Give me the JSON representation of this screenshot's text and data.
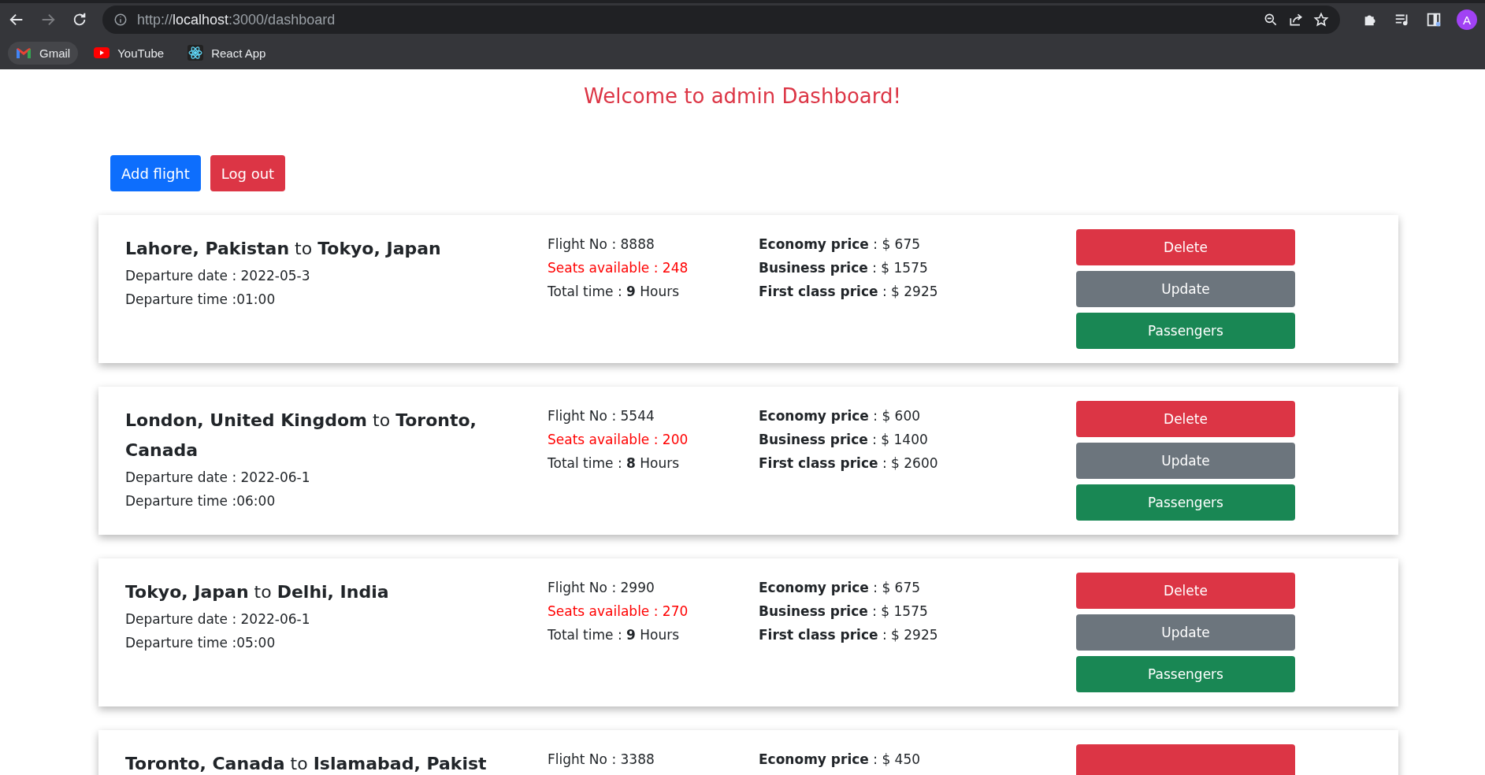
{
  "browser": {
    "url_scheme": "http://",
    "url_host": "localhost",
    "url_rest": ":3000/dashboard",
    "avatar": "A",
    "bookmarks": [
      {
        "label": "Gmail",
        "kind": "gmail",
        "highlighted": true
      },
      {
        "label": "YouTube",
        "kind": "youtube",
        "highlighted": false
      },
      {
        "label": "React App",
        "kind": "react",
        "highlighted": false
      }
    ]
  },
  "heading": "Welcome to admin Dashboard!",
  "actions": [
    {
      "label": "Add flight",
      "kind": "primary"
    },
    {
      "label": "Log out",
      "kind": "danger"
    }
  ],
  "flights": [
    {
      "route": "**Lahore, Pakistan** to **Tokyo, Japan**",
      "details": [
        "Departure date : 2022-05-3",
        "Departure time :01:00"
      ],
      "info": [
        {
          "text": "Flight No : 8888",
          "kind": "plain"
        },
        {
          "text": "Seats available : 248",
          "kind": "alert"
        },
        {
          "text": "Total time : **9** Hours",
          "kind": "plain"
        }
      ],
      "prices": [
        "**Economy price** : $ 675",
        "**Business price** : $ 1575",
        "**First class price** : $ 2925"
      ],
      "buttons": [
        {
          "label": "Delete",
          "kind": "danger"
        },
        {
          "label": "Update",
          "kind": "secondary"
        },
        {
          "label": "Passengers",
          "kind": "success"
        }
      ]
    },
    {
      "route": "**London, United Kingdom** to **Toronto, Canada**",
      "details": [
        "Departure date : 2022-06-1",
        "Departure time :06:00"
      ],
      "info": [
        {
          "text": "Flight No : 5544",
          "kind": "plain"
        },
        {
          "text": "Seats available : 200",
          "kind": "alert"
        },
        {
          "text": "Total time : **8** Hours",
          "kind": "plain"
        }
      ],
      "prices": [
        "**Economy price** : $ 600",
        "**Business price** : $ 1400",
        "**First class price** : $ 2600"
      ],
      "buttons": [
        {
          "label": "Delete",
          "kind": "danger"
        },
        {
          "label": "Update",
          "kind": "secondary"
        },
        {
          "label": "Passengers",
          "kind": "success"
        }
      ]
    },
    {
      "route": "**Tokyo, Japan** to **Delhi, India**",
      "details": [
        "Departure date : 2022-06-1",
        "Departure time :05:00"
      ],
      "info": [
        {
          "text": "Flight No : 2990",
          "kind": "plain"
        },
        {
          "text": "Seats available : 270",
          "kind": "alert"
        },
        {
          "text": "Total time : **9** Hours",
          "kind": "plain"
        }
      ],
      "prices": [
        "**Economy price** : $ 675",
        "**Business price** : $ 1575",
        "**First class price** : $ 2925"
      ],
      "buttons": [
        {
          "label": "Delete",
          "kind": "danger"
        },
        {
          "label": "Update",
          "kind": "secondary"
        },
        {
          "label": "Passengers",
          "kind": "success"
        }
      ]
    },
    {
      "route": "**Toronto, Canada** to **Islamabad, Pakist**",
      "info": [
        {
          "text": "Flight No : 3388",
          "kind": "plain"
        }
      ],
      "prices": [
        "**Economy price** : $ 450"
      ],
      "buttons": [
        {
          "kind": "danger"
        }
      ]
    }
  ]
}
